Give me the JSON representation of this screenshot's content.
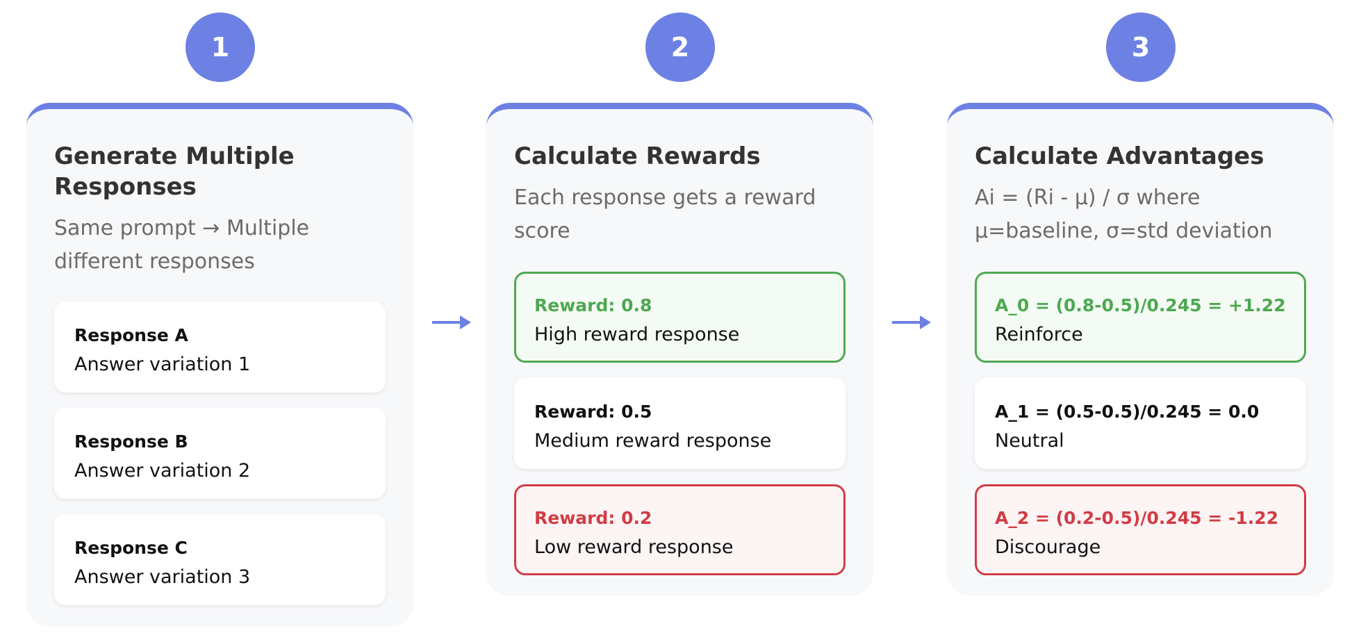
{
  "steps": [
    {
      "number": "1",
      "title": "Generate Multiple Responses",
      "description": "Same prompt → Multiple different responses",
      "items": [
        {
          "head": "Response A",
          "sub": "Answer variation 1",
          "style": "plain"
        },
        {
          "head": "Response B",
          "sub": "Answer variation 2",
          "style": "plain"
        },
        {
          "head": "Response C",
          "sub": "Answer variation 3",
          "style": "plain"
        }
      ]
    },
    {
      "number": "2",
      "title": "Calculate Rewards",
      "description": "Each response gets a reward score",
      "items": [
        {
          "head": "Reward: 0.8",
          "sub": "High reward response",
          "style": "good"
        },
        {
          "head": "Reward: 0.5",
          "sub": "Medium reward response",
          "style": "plain"
        },
        {
          "head": "Reward: 0.2",
          "sub": "Low reward response",
          "style": "bad"
        }
      ]
    },
    {
      "number": "3",
      "title": "Calculate Advantages",
      "description": "Ai = (Ri - μ) / σ where μ=baseline, σ=std deviation",
      "items": [
        {
          "head": "A_0 = (0.8-0.5)/0.245 = +1.22",
          "sub": "Reinforce",
          "style": "good"
        },
        {
          "head": "A_1 = (0.5-0.5)/0.245 = 0.0",
          "sub": "Neutral",
          "style": "plain"
        },
        {
          "head": "A_2 = (0.2-0.5)/0.245 = -1.22",
          "sub": "Discourage",
          "style": "bad"
        }
      ]
    }
  ],
  "colors": {
    "accent": "#6d80e3",
    "positive": "#4ea852",
    "negative": "#cf3d45",
    "card_background": "#f7f8fa"
  }
}
